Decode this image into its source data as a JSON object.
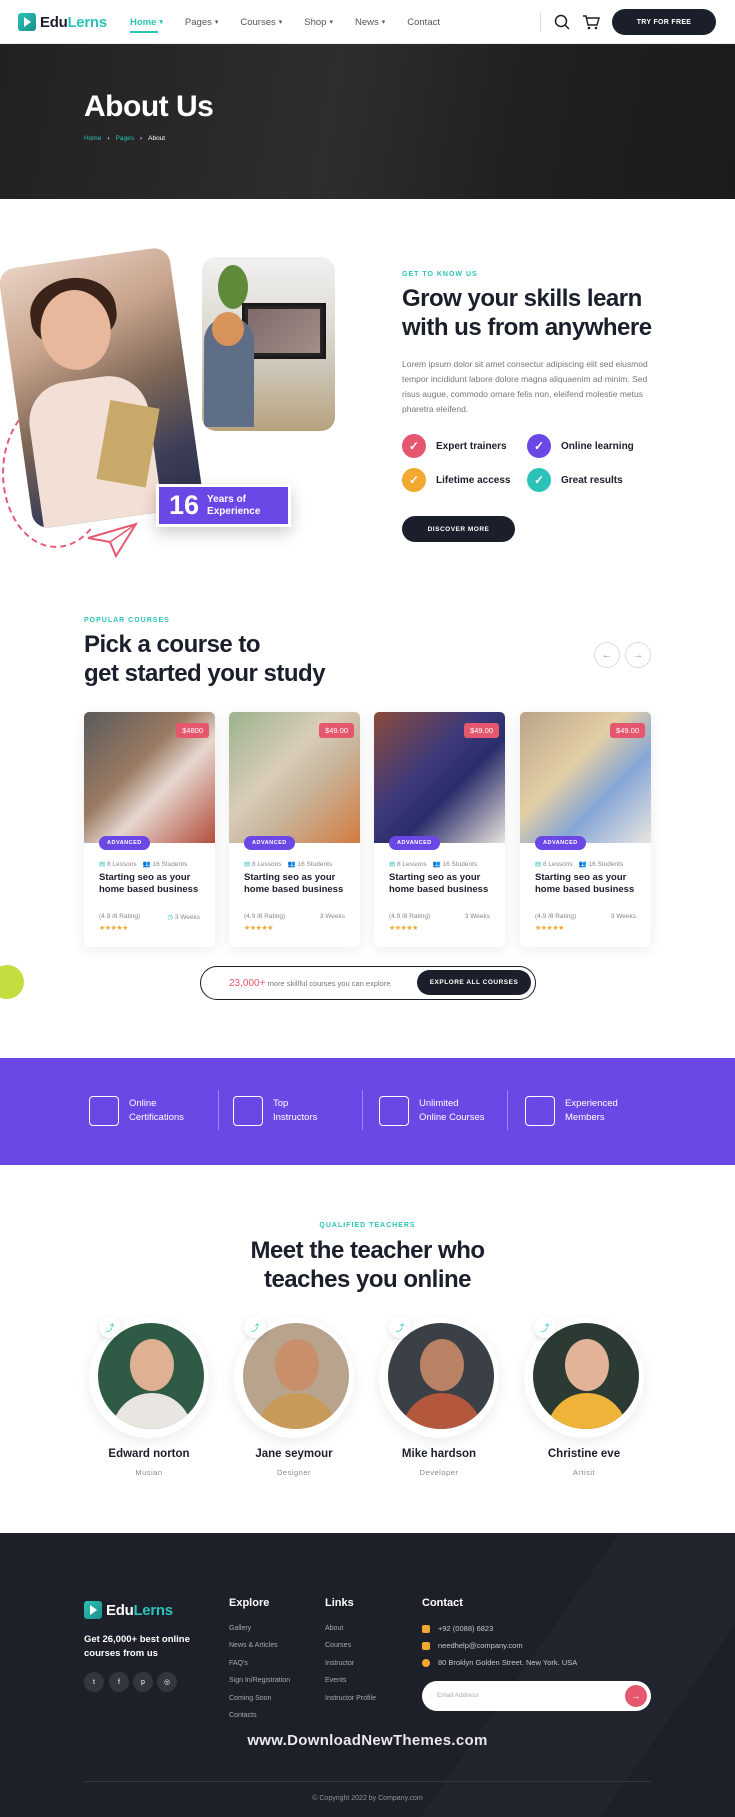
{
  "header": {
    "logo_prefix": "Edu",
    "logo_suffix": "Lerns",
    "nav": [
      "Home",
      "Pages",
      "Courses",
      "Shop",
      "News",
      "Contact"
    ],
    "cta": "TRY FOR FREE"
  },
  "hero": {
    "title": "About Us",
    "breadcrumb": [
      "Home",
      "Pages",
      "About"
    ]
  },
  "about": {
    "eyebrow": "GET TO KNOW US",
    "title": "Grow your skills learn with us from anywhere",
    "text": "Lorem ipsum dolor sit amet consectur adipiscing elit sed eiusmod tempor incididunt labore dolore magna aliquaenim ad minim. Sed risus augue, commodo ornare felis non, eleifend molestie metus pharetra eleifend.",
    "features": [
      "Expert trainers",
      "Online learning",
      "Lifetime access",
      "Great results"
    ],
    "feature_colors": [
      "#e5576e",
      "#6b48e6",
      "#f3a830",
      "#2bc3b8"
    ],
    "badge_number": "16",
    "badge_label_1": "Years of",
    "badge_label_2": "Experience",
    "button": "DISCOVER MORE"
  },
  "courses": {
    "eyebrow": "POPULAR COURSES",
    "title_1": "Pick a course to",
    "title_2": "get started your study",
    "items": [
      {
        "price": "$4800",
        "level": "ADVANCED",
        "lessons": "8 Lessons",
        "students": "16 Students",
        "title": "Starting seo as your home based business",
        "rating": "(4.9 /8 Rating)",
        "weeks": "3 Weeks",
        "stars": "★★★★★"
      },
      {
        "price": "$49.00",
        "level": "ADVANCED",
        "lessons": "8 Lessons",
        "students": "16 Students",
        "title": "Starting seo as your home based business",
        "rating": "(4.9 /8 Rating)",
        "weeks": "3 Weeks",
        "stars": "★★★★★"
      },
      {
        "price": "$49.00",
        "level": "ADVANCED",
        "lessons": "8 Lessons",
        "students": "16 Students",
        "title": "Starting seo as your home based business",
        "rating": "(4.9 /8 Rating)",
        "weeks": "3 Weeks",
        "stars": "★★★★★"
      },
      {
        "price": "$49.00",
        "level": "ADVANCED",
        "lessons": "8 Lessons",
        "students": "16 Students",
        "title": "Starting seo as your home based business",
        "rating": "(4.9 /8 Rating)",
        "weeks": "3 Weeks",
        "stars": "★★★★★"
      }
    ],
    "explore_count": "23,000+",
    "explore_text": " more skillful courses you can explore",
    "explore_button": "EXPLORE ALL COURSES"
  },
  "band": {
    "items": [
      {
        "line1": "Online",
        "line2": "Certifications"
      },
      {
        "line1": "Top",
        "line2": "Instructors"
      },
      {
        "line1": "Unlimited",
        "line2": "Online Courses"
      },
      {
        "line1": "Experienced",
        "line2": "Members"
      }
    ]
  },
  "teachers": {
    "eyebrow": "QUALIFIED TEACHERS",
    "title_1": "Meet the teacher who",
    "title_2": "teaches you online",
    "items": [
      {
        "name": "Edward norton",
        "role": "Musian"
      },
      {
        "name": "Jane seymour",
        "role": "Designer"
      },
      {
        "name": "Mike hardson",
        "role": "Developer"
      },
      {
        "name": "Christine eve",
        "role": "Artisit"
      }
    ]
  },
  "footer": {
    "logo_prefix": "Edu",
    "logo_suffix": "Lerns",
    "tagline": "Get 26,000+ best online courses from us",
    "explore_heading": "Explore",
    "explore_links": [
      "Gallery",
      "News & Articles",
      "FAQ's",
      "Sign In/Registration",
      "Coming Soon",
      "Contacts"
    ],
    "links_heading": "Links",
    "links": [
      "About",
      "Courses",
      "Instructor",
      "Events",
      "Instructor Profile"
    ],
    "contact_heading": "Contact",
    "phone": "+92 (0088) 6823",
    "email": "needhelp@company.com",
    "address": "80 Broklyn Golden Street. New York. USA",
    "email_placeholder": "Email Address",
    "watermark": "www.DownloadNewThemes.com",
    "copyright": "© Copyright 2022 by Company.com"
  }
}
